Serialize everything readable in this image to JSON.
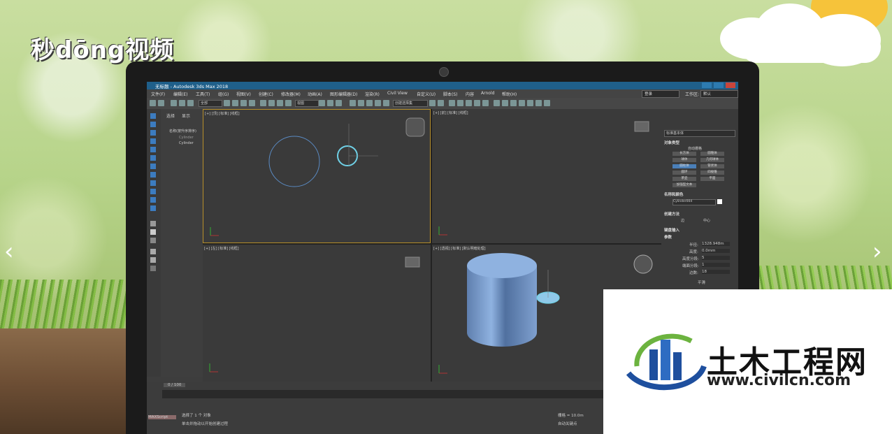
{
  "brand": {
    "logo": "秒dōng视频"
  },
  "nav": {
    "prev": "‹",
    "next": "›"
  },
  "window": {
    "title": "无标题 - Autodesk 3ds Max 2018",
    "menus": [
      "文件(F)",
      "编辑(E)",
      "工具(T)",
      "组(G)",
      "视图(V)",
      "创建(C)",
      "修改器(M)",
      "动画(A)",
      "图形编辑器(D)",
      "渲染(R)",
      "Civil View",
      "自定义(U)",
      "脚本(S)",
      "内容",
      "Arnold",
      "帮助(H)"
    ],
    "login": "登录",
    "workspace_label": "工作区:",
    "workspace_value": "默认"
  },
  "toolbar": {
    "filter": "全部",
    "view": "视图",
    "selection_set": "创建选择集"
  },
  "scene_explorer": {
    "tabs": [
      "选择",
      "显示"
    ],
    "header": "名称(按升序排序)",
    "items": [
      "Cylinder",
      "Cylinder"
    ]
  },
  "viewports": {
    "top": "[+] [顶] [标准] [线框]",
    "front": "[+] [前] [标准] [线框]",
    "left": "[+] [左] [标准] [线框]",
    "perspective": "[+] [透视] [标准] [默认明暗处理]"
  },
  "command_panel": {
    "category": "标准基本体",
    "object_type": "对象类型",
    "autogrid": "自动栅格",
    "buttons": [
      "长方体",
      "圆锥体",
      "球体",
      "几何球体",
      "圆柱体",
      "管状体",
      "圆环",
      "四棱锥",
      "茶壶",
      "平面",
      "加强型文本"
    ],
    "active_button": "圆柱体",
    "name_color": "名称和颜色",
    "object_name": "Cylinder004",
    "creation_method": "创建方法",
    "method_edge": "边",
    "method_center": "中心",
    "keyboard_entry": "键盘输入",
    "params": "参数",
    "radius_label": "半径:",
    "radius_value": "1328.948m",
    "height_label": "高度:",
    "height_value": "0.0mm",
    "height_segs_label": "高度分段:",
    "height_segs_value": "5",
    "cap_segs_label": "端面分段:",
    "cap_segs_value": "1",
    "sides_label": "边数:",
    "sides_value": "18",
    "smooth": "平滑"
  },
  "status": {
    "frame": "0 / 100",
    "selected": "选择了 1 个 对象",
    "hint": "单击并拖动以开始创建过程",
    "script": "MAXScript",
    "grid": "栅格 = 10.0m",
    "autokey": "自动关键点"
  },
  "watermark": {
    "main": "土木工程网",
    "url": "www.civilcn.com"
  },
  "colors": {
    "titlebar": "#1f5f8a",
    "accent": "#4a7fb8",
    "cylinder": "#8fb2e0",
    "selection": "#6fd0e6"
  }
}
